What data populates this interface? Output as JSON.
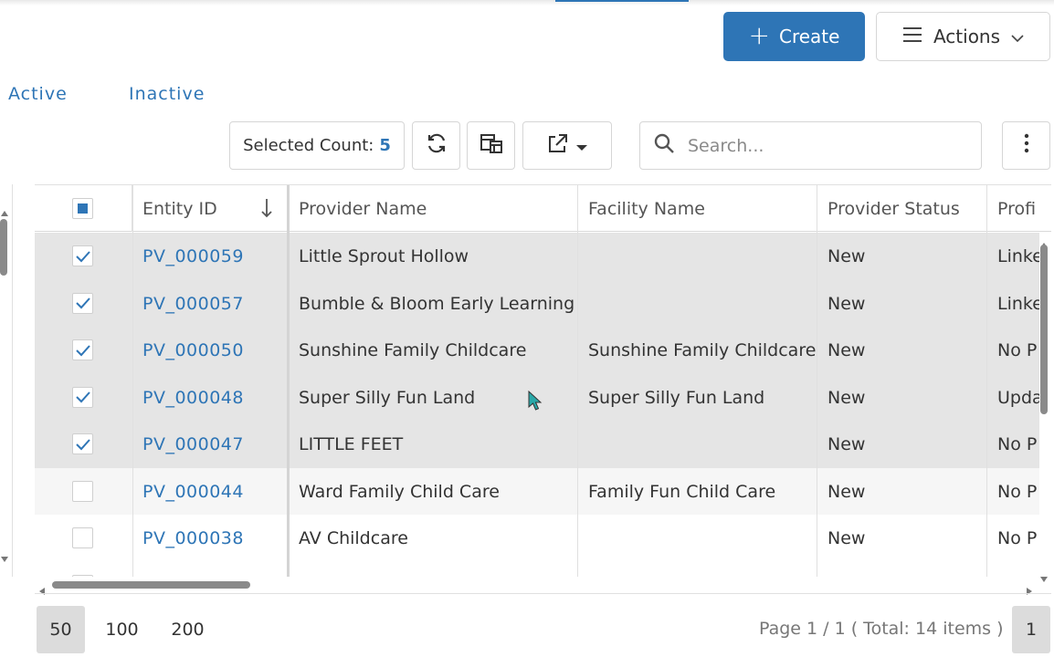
{
  "header": {
    "create_label": "Create",
    "actions_label": "Actions",
    "accent_color": "#2e75b6"
  },
  "tabs": [
    {
      "label": "Active"
    },
    {
      "label": "Inactive"
    }
  ],
  "toolbar": {
    "selected_count_label": "Selected Count:",
    "selected_count_value": "5",
    "search_placeholder": "Search...",
    "icons": [
      "refresh-icon",
      "column-chooser-icon",
      "export-icon",
      "chevron-down-icon",
      "search-icon",
      "more-vertical-icon"
    ]
  },
  "grid": {
    "columns": [
      "Entity ID",
      "Provider Name",
      "Facility Name",
      "Provider Status",
      "Profi"
    ],
    "sort_column": "Entity ID",
    "sort_direction": "descending",
    "header_checkbox_state": "indeterminate",
    "rows": [
      {
        "id": "PV_000059",
        "provider": "Little Sprout Hollow",
        "facility": "",
        "status": "New",
        "profile": "Linke",
        "selected": true
      },
      {
        "id": "PV_000057",
        "provider": "Bumble & Bloom Early Learning",
        "facility": "",
        "status": "New",
        "profile": "Linke",
        "selected": true
      },
      {
        "id": "PV_000050",
        "provider": "Sunshine Family Childcare",
        "facility": "Sunshine Family Childcare",
        "status": "New",
        "profile": "No P",
        "selected": true
      },
      {
        "id": "PV_000048",
        "provider": "Super Silly Fun Land",
        "facility": "Super Silly Fun Land",
        "status": "New",
        "profile": "Upda",
        "selected": true
      },
      {
        "id": "PV_000047",
        "provider": "LITTLE FEET",
        "facility": "",
        "status": "New",
        "profile": "No P",
        "selected": true
      },
      {
        "id": "PV_000044",
        "provider": "Ward Family Child Care",
        "facility": "Family Fun Child Care",
        "status": "New",
        "profile": "No P",
        "selected": false
      },
      {
        "id": "PV_000038",
        "provider": "AV Childcare",
        "facility": "",
        "status": "New",
        "profile": "No P",
        "selected": false
      }
    ]
  },
  "footer": {
    "page_sizes": [
      "50",
      "100",
      "200"
    ],
    "active_page_size": "50",
    "page_info": "Page 1 / 1 ( Total: 14 items )",
    "current_page": "1"
  }
}
